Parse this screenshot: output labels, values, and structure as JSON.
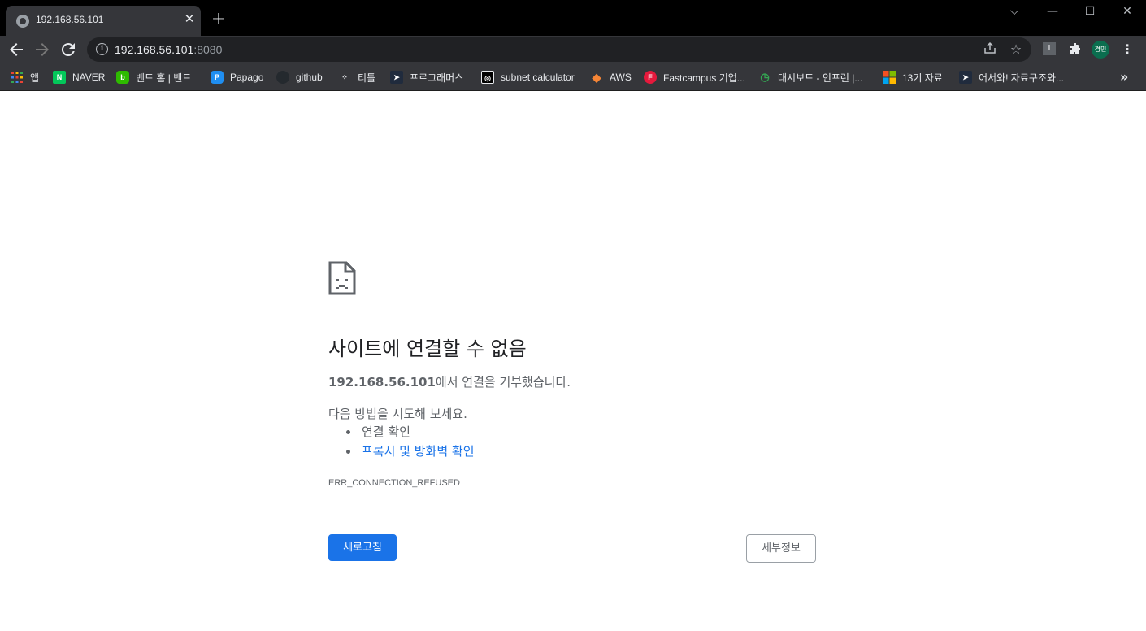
{
  "tab": {
    "title": "192.168.56.101",
    "close": "✕"
  },
  "new_tab": "+",
  "window_controls": {
    "dropdown": "⌵",
    "minimize": "—",
    "maximize": "☐",
    "close": "✕"
  },
  "address": {
    "host": "192.168.56.101",
    "port": ":8080"
  },
  "profile": {
    "initials": "경민",
    "color": "#0b6e4f"
  },
  "bookmarks": [
    {
      "label": "앱",
      "icon": "apps-grid-icon"
    },
    {
      "label": "NAVER",
      "icon": "naver-icon",
      "color": "#03c75a",
      "glyph": "N"
    },
    {
      "label": "밴드 홈 | 밴드",
      "icon": "band-icon",
      "color": "#2ebb00",
      "glyph": "b"
    },
    {
      "label": "Papago",
      "icon": "papago-icon",
      "color": "#1f8ef1",
      "glyph": "P"
    },
    {
      "label": "github",
      "icon": "github-icon",
      "color": "#24292e",
      "glyph": "●"
    },
    {
      "label": "티툴",
      "icon": "titool-icon",
      "color": "#35363a",
      "glyph": "⋰"
    },
    {
      "label": "프로그래머스",
      "icon": "programmers-icon",
      "color": "#202b3d",
      "glyph": "➤"
    },
    {
      "label": "subnet calculator",
      "icon": "subnet-icon",
      "color": "#000000",
      "glyph": "◎"
    },
    {
      "label": "AWS",
      "icon": "aws-icon",
      "color": "#f58536",
      "glyph": "◆"
    },
    {
      "label": "Fastcampus 기업...",
      "icon": "fastcampus-icon",
      "color": "#e5193c",
      "glyph": "F"
    },
    {
      "label": "대시보드 - 인프런 |...",
      "icon": "inflearn-icon",
      "color": "#35363a",
      "glyph": "◷"
    },
    {
      "label": "13기 자료",
      "icon": "microsoft-icon",
      "color": "#f25022",
      "glyph": ""
    },
    {
      "label": "어서와! 자료구조와...",
      "icon": "programmers-icon",
      "color": "#202b3d",
      "glyph": "➤"
    }
  ],
  "bookmarks_more": "»",
  "error": {
    "title": "사이트에 연결할 수 없음",
    "host": "192.168.56.101",
    "message": "에서 연결을 거부했습니다.",
    "try_text": "다음 방법을 시도해 보세요.",
    "suggestions": [
      "연결 확인",
      "프록시 및 방화벽 확인"
    ],
    "code": "ERR_CONNECTION_REFUSED",
    "reload_label": "새로고침",
    "details_label": "세부정보"
  },
  "colors": {
    "accent": "#1a73e8",
    "toolbar": "#35363a",
    "titlebar": "#000000"
  }
}
